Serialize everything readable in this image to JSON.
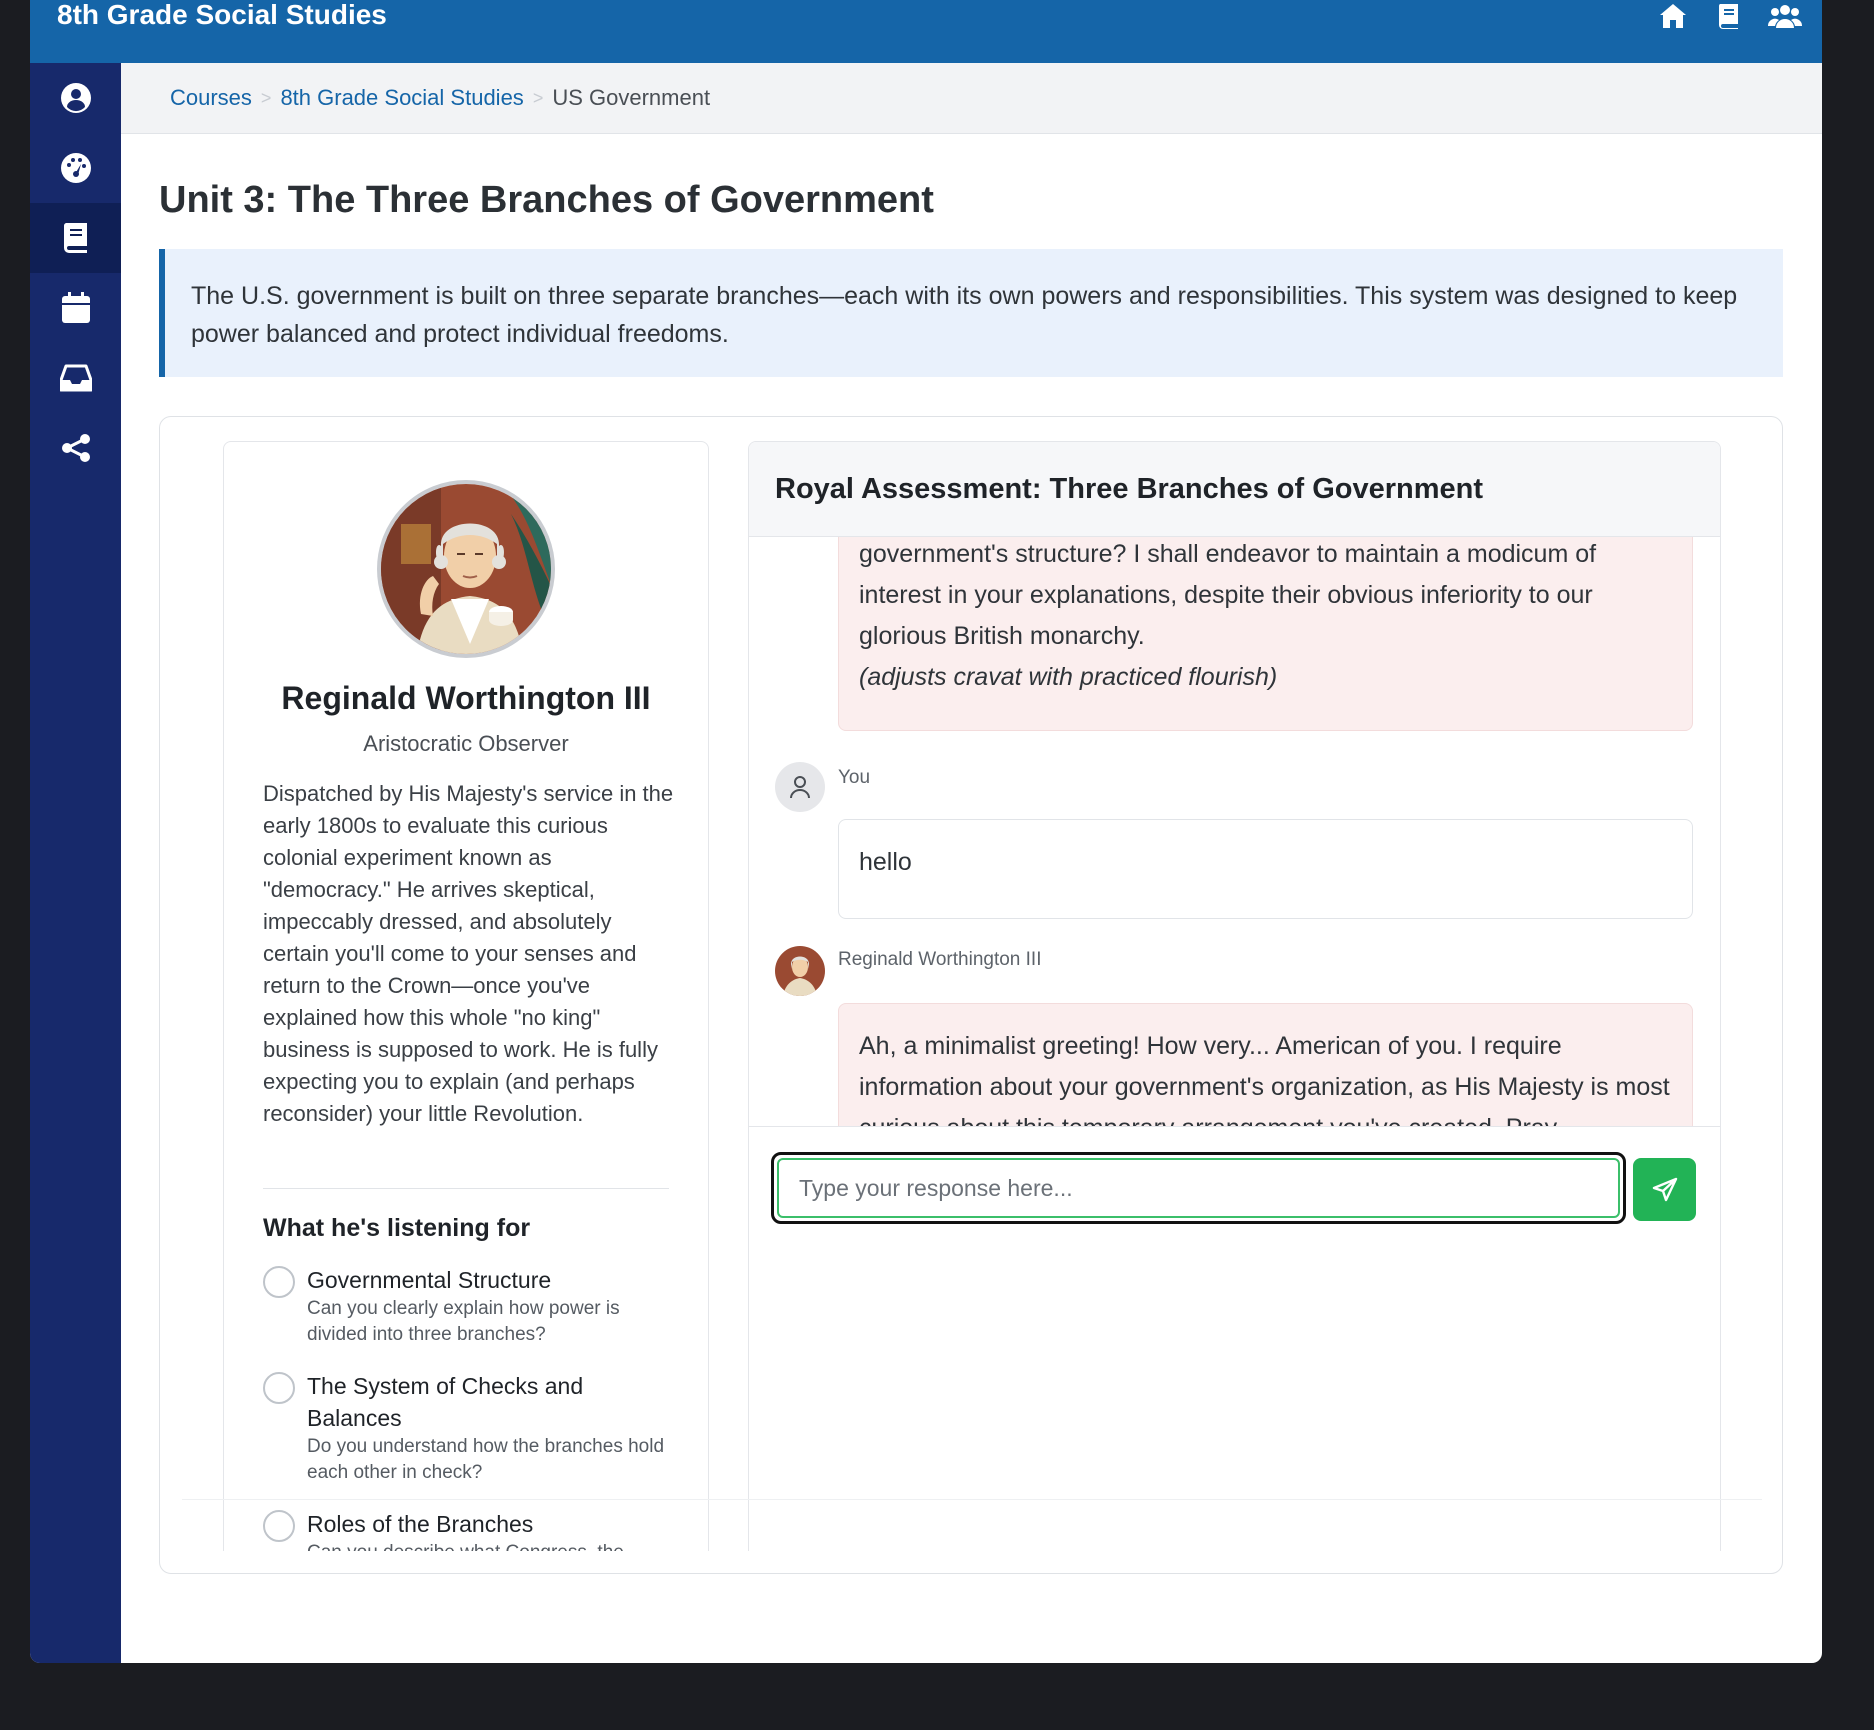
{
  "app": {
    "title": "8th Grade Social Studies",
    "top_icons": [
      "home-icon",
      "book-icon",
      "users-icon"
    ]
  },
  "sidebar": {
    "items": [
      {
        "icon": "user-circle-icon",
        "active": false
      },
      {
        "icon": "dashboard-icon",
        "active": false
      },
      {
        "icon": "book-icon",
        "active": true
      },
      {
        "icon": "calendar-icon",
        "active": false
      },
      {
        "icon": "inbox-icon",
        "active": false
      },
      {
        "icon": "share-icon",
        "active": false
      }
    ]
  },
  "breadcrumb": {
    "items": [
      "Courses",
      "8th Grade Social Studies"
    ],
    "current": "US Government",
    "separator": ">"
  },
  "page": {
    "title": "Unit 3: The Three Branches of Government",
    "intro": "The U.S. government is built on three separate branches—each with its own powers and responsibilities. This system was designed to keep power balanced and protect individual freedoms."
  },
  "character": {
    "name": "Reginald Worthington III",
    "role": "Aristocratic Observer",
    "bio": "Dispatched by His Majesty's service in the early 1800s to evaluate this curious colonial experiment known as \"democracy.\" He arrives skeptical, impeccably dressed, and absolutely certain you'll come to your senses and return to the Crown—once you've explained how this whole \"no king\" business is supposed to work. He is fully expecting you to explain (and perhaps reconsider) your little Revolution.",
    "listening_heading": "What he's listening for",
    "criteria": [
      {
        "title": "Governmental Structure",
        "desc": "Can you clearly explain how power is divided into three branches?"
      },
      {
        "title": "The System of Checks and Balances",
        "desc": "Do you understand how the branches hold each other in check?"
      },
      {
        "title": "Roles of the Branches",
        "desc": "Can you describe what Congress, the"
      }
    ]
  },
  "chat": {
    "title": "Royal Assessment: Three Branches of Government",
    "messages": [
      {
        "sender": "bot",
        "text": "government's structure? I shall endeavor to maintain a modicum of interest in your explanations, despite their obvious inferiority to our glorious British monarchy.",
        "stage": "(adjusts cravat with practiced flourish)"
      },
      {
        "sender": "user",
        "label": "You",
        "text": "hello"
      },
      {
        "sender": "bot",
        "label": "Reginald Worthington III",
        "text": "Ah, a minimalist greeting! How very... American of you. I require information about your government's organization, as His Majesty is most curious about this temporary arrangement you've created. Pray"
      }
    ],
    "input_placeholder": "Type your response here...",
    "send_icon": "send-icon"
  },
  "colors": {
    "topbar": "#1565a8",
    "sidebar": "#17296b",
    "accent_green": "#22b356",
    "bot_bubble": "#fbeeee",
    "intro_bg": "#e9f1fc"
  }
}
